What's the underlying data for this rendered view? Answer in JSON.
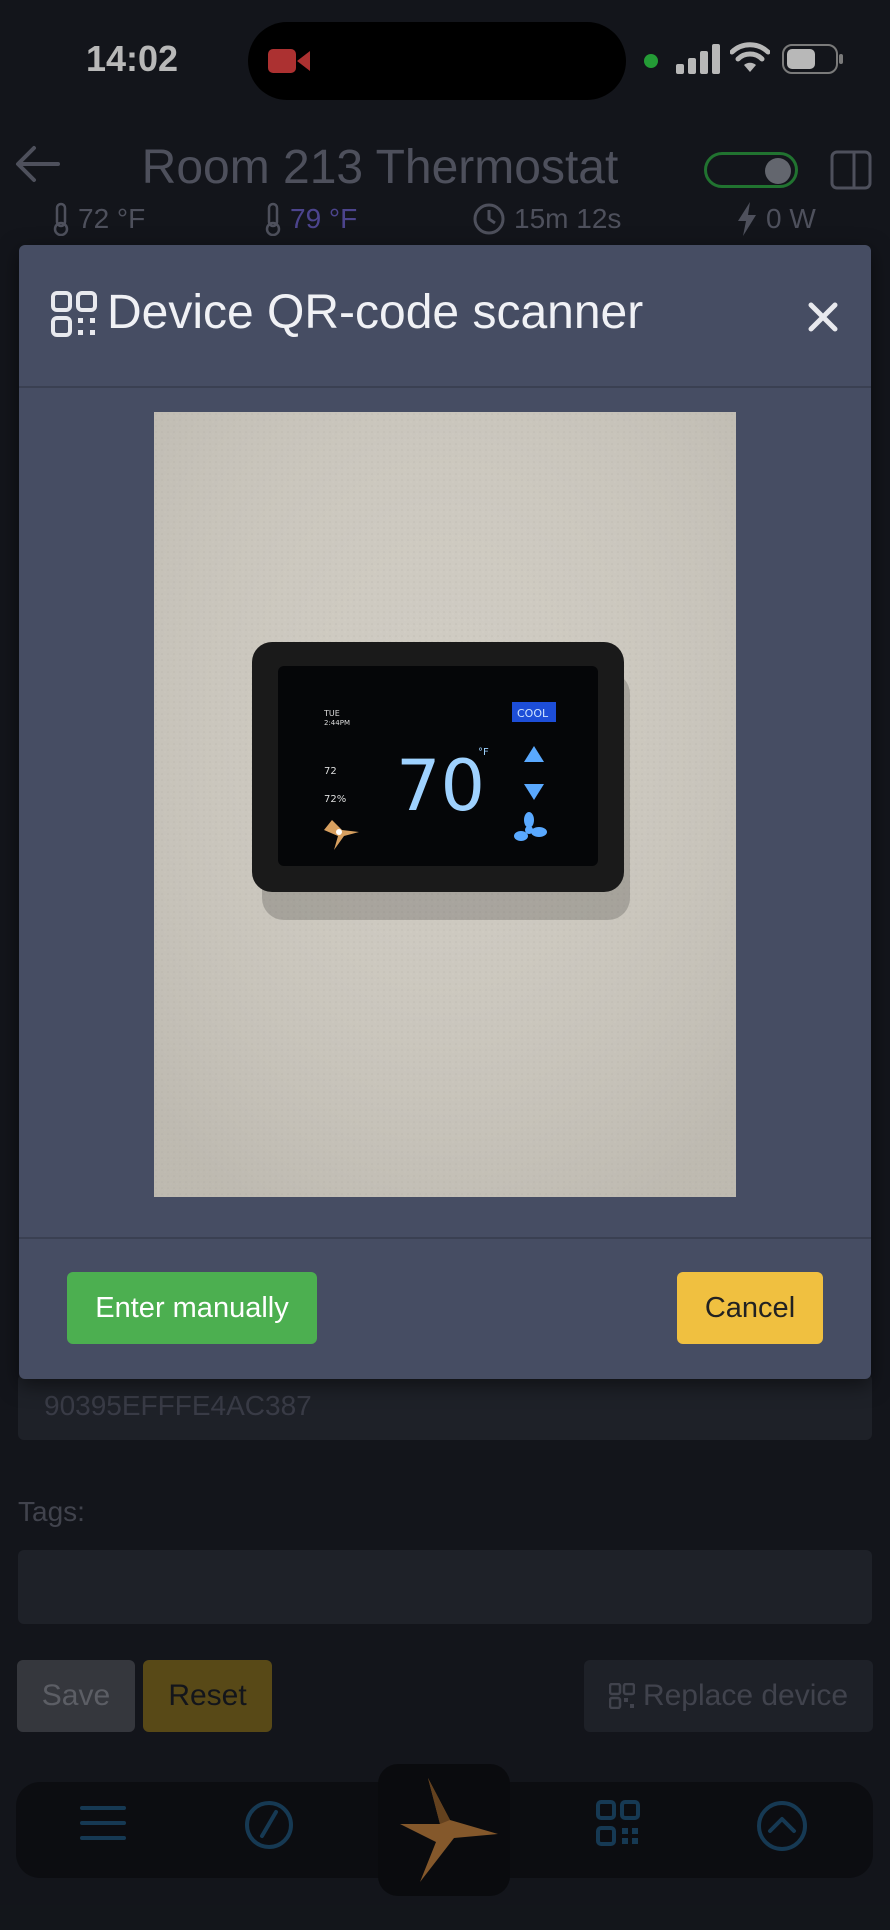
{
  "status_bar": {
    "time": "14:02"
  },
  "header": {
    "title": "Room 213 Thermostat",
    "stats": {
      "temp_indoor": "72 °F",
      "temp_outdoor": "79 °F",
      "runtime": "15m 12s",
      "power": "0 W"
    }
  },
  "form": {
    "serial_value": "90395EFFFE4AC387",
    "tags_label": "Tags:",
    "tags_value": "",
    "save_label": "Save",
    "reset_label": "Reset",
    "replace_label": "Replace device"
  },
  "modal": {
    "title": "Device QR-code scanner",
    "close_label": "×",
    "manual_label": "Enter manually",
    "cancel_label": "Cancel"
  },
  "camera": {
    "thermostat_day": "TUE",
    "thermostat_time": "2:44PM",
    "thermostat_setpoint": "70",
    "thermostat_unit": "°F",
    "thermostat_mode": "COOL",
    "thermostat_room": "72",
    "thermostat_humidity": "72%"
  },
  "colors": {
    "accent_green": "#4caf50",
    "accent_yellow": "#f0c040",
    "modal_bg": "#464d63"
  }
}
